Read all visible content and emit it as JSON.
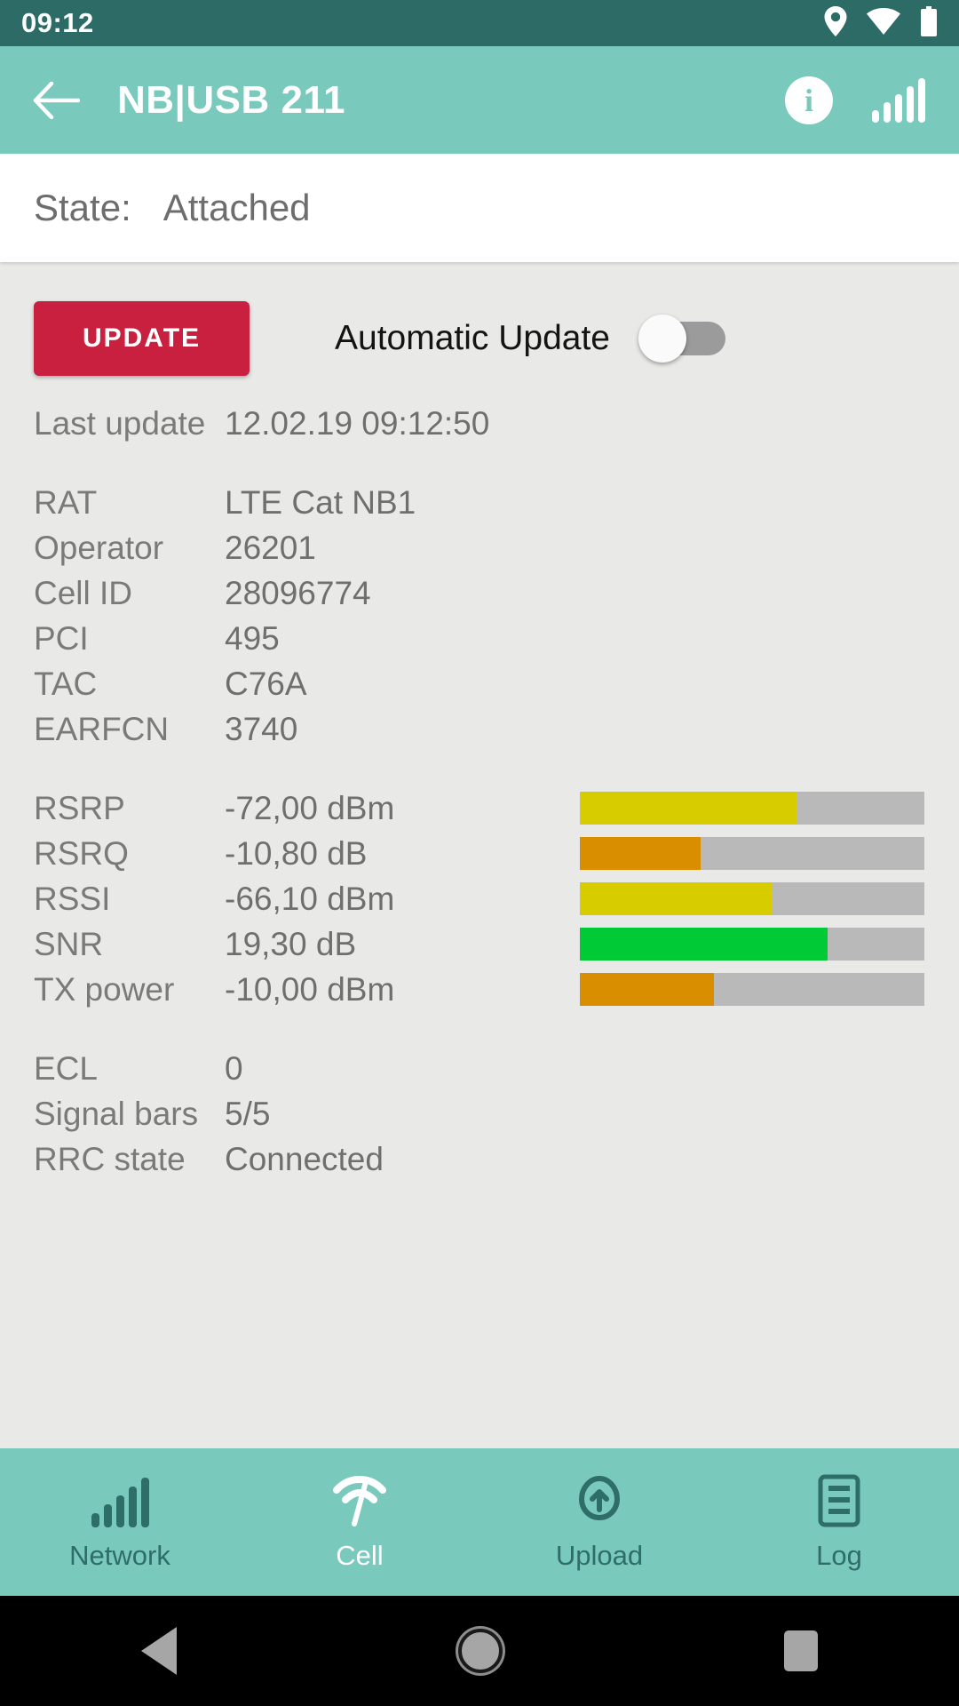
{
  "statusbar": {
    "clock": "09:12",
    "icons": [
      "location-icon",
      "wifi-icon",
      "battery-icon"
    ]
  },
  "appbar": {
    "back_icon": "back-arrow-icon",
    "title": "NB|USB 211",
    "info_icon": "info-icon",
    "signal_icon": "signal-bars-icon"
  },
  "state_card": {
    "label": "State:",
    "value": "Attached"
  },
  "controls": {
    "update_label": "UPDATE",
    "auto_update_label": "Automatic Update",
    "auto_update_on": false
  },
  "info_rows": [
    {
      "key": "Last update",
      "value": "12.02.19 09:12:50"
    }
  ],
  "cell_rows": [
    {
      "key": "RAT",
      "value": "LTE Cat NB1"
    },
    {
      "key": "Operator",
      "value": "26201"
    },
    {
      "key": "Cell ID",
      "value": "28096774"
    },
    {
      "key": "PCI",
      "value": "495"
    },
    {
      "key": "TAC",
      "value": "C76A"
    },
    {
      "key": "EARFCN",
      "value": "3740"
    }
  ],
  "signal_rows": [
    {
      "key": "RSRP",
      "value": "-72,00 dBm",
      "percent": 63,
      "color": "#d6cc00"
    },
    {
      "key": "RSRQ",
      "value": "-10,80 dB",
      "percent": 35,
      "color": "#d98e00"
    },
    {
      "key": "RSSI",
      "value": "-66,10 dBm",
      "percent": 56,
      "color": "#d6cc00"
    },
    {
      "key": "SNR",
      "value": "19,30 dB",
      "percent": 72,
      "color": "#00ca36"
    },
    {
      "key": "TX power",
      "value": "-10,00 dBm",
      "percent": 39,
      "color": "#d98e00"
    }
  ],
  "status_rows": [
    {
      "key": "ECL",
      "value": "0"
    },
    {
      "key": "Signal bars",
      "value": "5/5"
    },
    {
      "key": "RRC state",
      "value": "Connected"
    }
  ],
  "bottomnav": [
    {
      "label": "Network",
      "icon": "signal-bars-icon",
      "active": false
    },
    {
      "label": "Cell",
      "icon": "cell-antenna-icon",
      "active": true
    },
    {
      "label": "Upload",
      "icon": "cloud-upload-icon",
      "active": false
    },
    {
      "label": "Log",
      "icon": "log-list-icon",
      "active": false
    }
  ],
  "androidnav": {
    "back": "android-back-icon",
    "home": "android-home-icon",
    "recents": "android-recents-icon"
  },
  "colors": {
    "accent": "#79c9bd",
    "statusbar": "#2d6b66",
    "update_button": "#c9203f",
    "page_bg": "#e9e9e7",
    "bar_track": "#b9b9b9"
  }
}
